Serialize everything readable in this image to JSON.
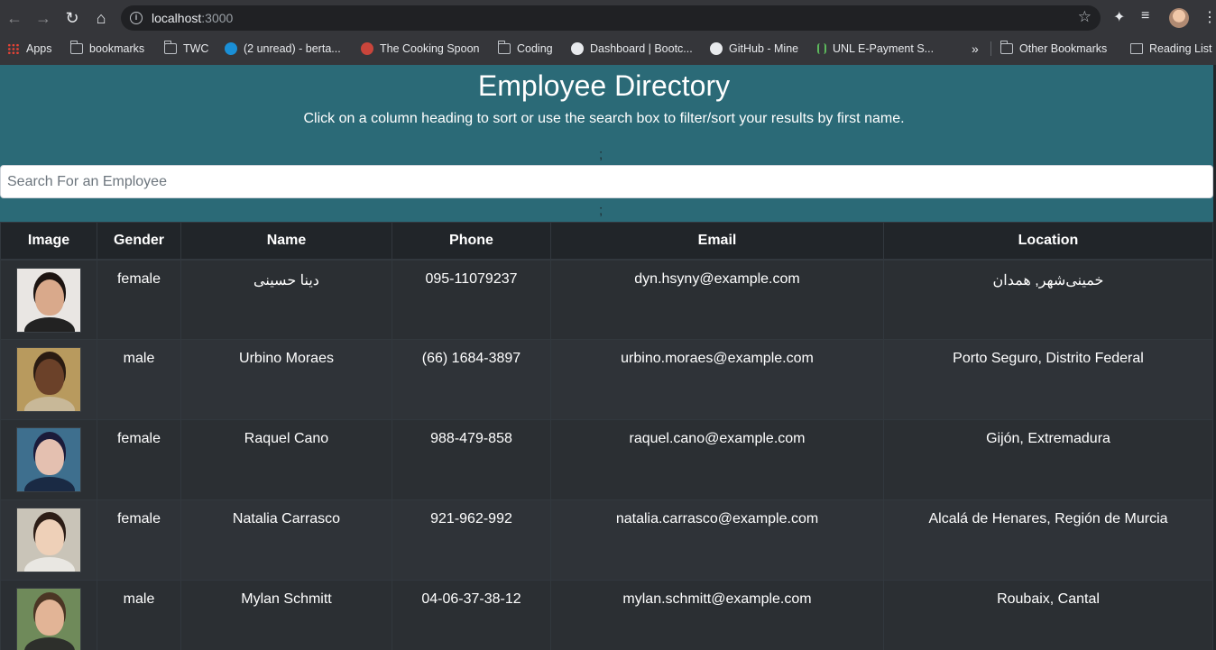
{
  "browser": {
    "url_host": "localhost",
    "url_port": ":3000",
    "bookmarks": [
      {
        "label": "Apps",
        "icon": "apps-grid-icon"
      },
      {
        "label": "bookmarks",
        "icon": "folder-icon"
      },
      {
        "label": "TWC",
        "icon": "folder-icon"
      },
      {
        "label": "(2 unread) - berta...",
        "icon": "att-icon"
      },
      {
        "label": "The Cooking Spoon",
        "icon": "spoon-icon"
      },
      {
        "label": "Coding",
        "icon": "folder-icon"
      },
      {
        "label": "Dashboard | Bootc...",
        "icon": "bootcamp-icon"
      },
      {
        "label": "GitHub - Mine",
        "icon": "github-icon"
      },
      {
        "label": "UNL E-Payment S...",
        "icon": "unl-icon"
      }
    ],
    "overflow_label": "»",
    "other_bookmarks": "Other Bookmarks",
    "reading_list": "Reading List"
  },
  "hero": {
    "title": "Employee Directory",
    "subtitle": "Click on a column heading to sort or use the search box to filter/sort your results by first name.",
    "stray_char": ";"
  },
  "search": {
    "placeholder": "Search For an Employee",
    "value": ""
  },
  "table": {
    "headers": [
      "Image",
      "Gender",
      "Name",
      "Phone",
      "Email",
      "Location"
    ],
    "rows": [
      {
        "gender": "female",
        "name": "دینا حسینی",
        "phone": "095-11079237",
        "email": "dyn.hsyny@example.com",
        "location": "خمینی‌شهر, همدان",
        "photo": {
          "skin": "#d9a98b",
          "hair": "#1c1411",
          "shirt": "#222",
          "bg": "#e9e6e3"
        }
      },
      {
        "gender": "male",
        "name": "Urbino Moraes",
        "phone": "(66) 1684-3897",
        "email": "urbino.moraes@example.com",
        "location": "Porto Seguro, Distrito Federal",
        "photo": {
          "skin": "#6b4129",
          "hair": "#2a1b12",
          "shirt": "#c8b898",
          "bg": "#b89a5e"
        }
      },
      {
        "gender": "female",
        "name": "Raquel Cano",
        "phone": "988-479-858",
        "email": "raquel.cano@example.com",
        "location": "Gijón, Extremadura",
        "photo": {
          "skin": "#e4c0b0",
          "hair": "#1b1b3a",
          "shirt": "#1a2a44",
          "bg": "#3e6f8e"
        }
      },
      {
        "gender": "female",
        "name": "Natalia Carrasco",
        "phone": "921-962-992",
        "email": "natalia.carrasco@example.com",
        "location": "Alcalá de Henares, Región de Murcia",
        "photo": {
          "skin": "#eed0b8",
          "hair": "#2c1d16",
          "shirt": "#e9e7e2",
          "bg": "#c9c4b8"
        }
      },
      {
        "gender": "male",
        "name": "Mylan Schmitt",
        "phone": "04-06-37-38-12",
        "email": "mylan.schmitt@example.com",
        "location": "Roubaix, Cantal",
        "photo": {
          "skin": "#e2b496",
          "hair": "#4b3524",
          "shirt": "#2d2f2b",
          "bg": "#6f8a5a"
        }
      }
    ]
  }
}
